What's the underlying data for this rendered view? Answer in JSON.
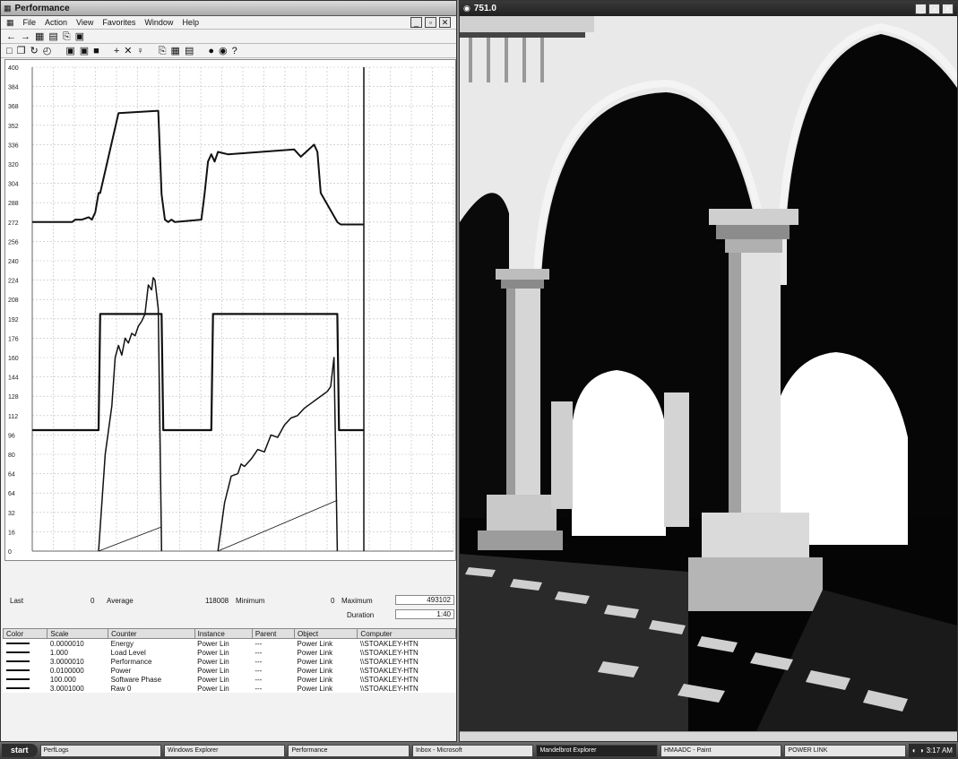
{
  "perfmon": {
    "title": "Performance",
    "menu": [
      "File",
      "Action",
      "View",
      "Favorites",
      "Window",
      "Help"
    ],
    "nav_toolbar": [
      "←",
      "→",
      "▦",
      "▤",
      "⎘",
      "▣"
    ],
    "toolbar": [
      "□",
      "❐",
      "↻",
      "◴",
      "▣",
      "▣",
      "■",
      "+",
      "✕",
      "♀",
      "⎘",
      "▦",
      "▤",
      "●",
      "◉",
      "?"
    ],
    "stats": {
      "last_label": "Last",
      "last_value": "0",
      "average_label": "Average",
      "average_value": "118008",
      "minimum_label": "Minimum",
      "minimum_value": "0",
      "maximum_label": "Maximum",
      "maximum_value": "493102",
      "duration_label": "Duration",
      "duration_value": "1:40"
    },
    "table": {
      "headers": [
        "Color",
        "Scale",
        "Counter",
        "Instance",
        "Parent",
        "Object",
        "Computer"
      ],
      "rows": [
        [
          "0.0000010",
          "Energy",
          "Power Lin",
          "---",
          "Power Link",
          "\\\\STOAKLEY-HTN"
        ],
        [
          "1.000",
          "Load Level",
          "Power Lin",
          "---",
          "Power Link",
          "\\\\STOAKLEY-HTN"
        ],
        [
          "3.0000010",
          "Performance",
          "Power Lin",
          "---",
          "Power Link",
          "\\\\STOAKLEY-HTN"
        ],
        [
          "0.0100000",
          "Power",
          "Power Lin",
          "---",
          "Power Link",
          "\\\\STOAKLEY-HTN"
        ],
        [
          "100.000",
          "Software Phase",
          "Power Lin",
          "---",
          "Power Link",
          "\\\\STOAKLEY-HTN"
        ],
        [
          "3.0001000",
          "Raw 0",
          "Power Lin",
          "---",
          "Power Link",
          "\\\\STOAKLEY-HTN"
        ]
      ]
    }
  },
  "chart_data": {
    "type": "line",
    "ylim": [
      0,
      400
    ],
    "yticks": [
      0,
      16,
      32,
      48,
      64,
      80,
      96,
      112,
      128,
      144,
      160,
      176,
      192,
      208,
      224,
      240,
      256,
      272,
      288,
      304,
      320,
      336,
      352,
      368,
      384,
      400
    ],
    "ytick_labels": [
      "0",
      "16",
      "32",
      "64",
      "64",
      "80",
      "96",
      "112",
      "128",
      "144",
      "160",
      "176",
      "192",
      "208",
      "224",
      "240",
      "256",
      "272",
      "288",
      "304",
      "320",
      "336",
      "352",
      "368",
      "384",
      "400"
    ],
    "xlim": [
      0,
      100
    ],
    "grid": true,
    "series": [
      {
        "x": [
          0,
          12,
          13,
          15,
          17,
          18,
          19,
          20,
          20.5,
          26,
          38,
          39,
          40,
          41,
          42,
          43,
          51,
          52,
          53,
          54,
          55,
          56,
          59,
          79,
          81,
          85,
          86,
          87,
          92,
          93,
          100
        ],
        "values": [
          272,
          272,
          274,
          274,
          276,
          274,
          280,
          296,
          296,
          362,
          364,
          295,
          274,
          272,
          274,
          272,
          274,
          296,
          322,
          328,
          322,
          330,
          328,
          332,
          326,
          336,
          330,
          296,
          272,
          270,
          270
        ]
      },
      {
        "x": [
          0,
          20,
          20.5,
          39,
          39.5,
          54,
          54.5,
          92,
          92.5,
          100
        ],
        "values": [
          100,
          100,
          196,
          196,
          100,
          100,
          196,
          196,
          100,
          100
        ]
      },
      {
        "x": [
          20,
          22,
          24,
          25,
          26,
          27,
          28,
          29,
          30,
          31,
          32,
          33,
          34,
          35,
          36,
          36.5,
          37,
          38,
          39
        ],
        "values": [
          0,
          80,
          120,
          160,
          170,
          162,
          176,
          172,
          180,
          178,
          186,
          190,
          196,
          220,
          216,
          226,
          224,
          200,
          0
        ]
      },
      {
        "x": [
          56,
          58,
          60,
          62,
          63,
          64,
          66,
          68,
          70,
          72,
          74,
          76,
          78,
          80,
          82,
          84,
          86,
          88,
          89,
          90,
          91,
          92
        ],
        "values": [
          0,
          40,
          62,
          64,
          72,
          70,
          76,
          84,
          82,
          96,
          94,
          104,
          110,
          112,
          118,
          122,
          126,
          130,
          132,
          136,
          160,
          0
        ]
      },
      {
        "x": [
          20,
          39
        ],
        "values": [
          0,
          20
        ]
      },
      {
        "x": [
          56,
          92
        ],
        "values": [
          0,
          42
        ]
      }
    ]
  },
  "render_window": {
    "title": "751.0"
  },
  "taskbar": {
    "start": "start",
    "tasks": [
      "PerfLogs",
      "Windows Explorer",
      "Performance",
      "Inbox - Microsoft",
      "Mandelbrot Explorer",
      "HMAADC - Paint",
      "POWER LINK"
    ],
    "active_index": 4,
    "clock": "3:17 AM"
  }
}
